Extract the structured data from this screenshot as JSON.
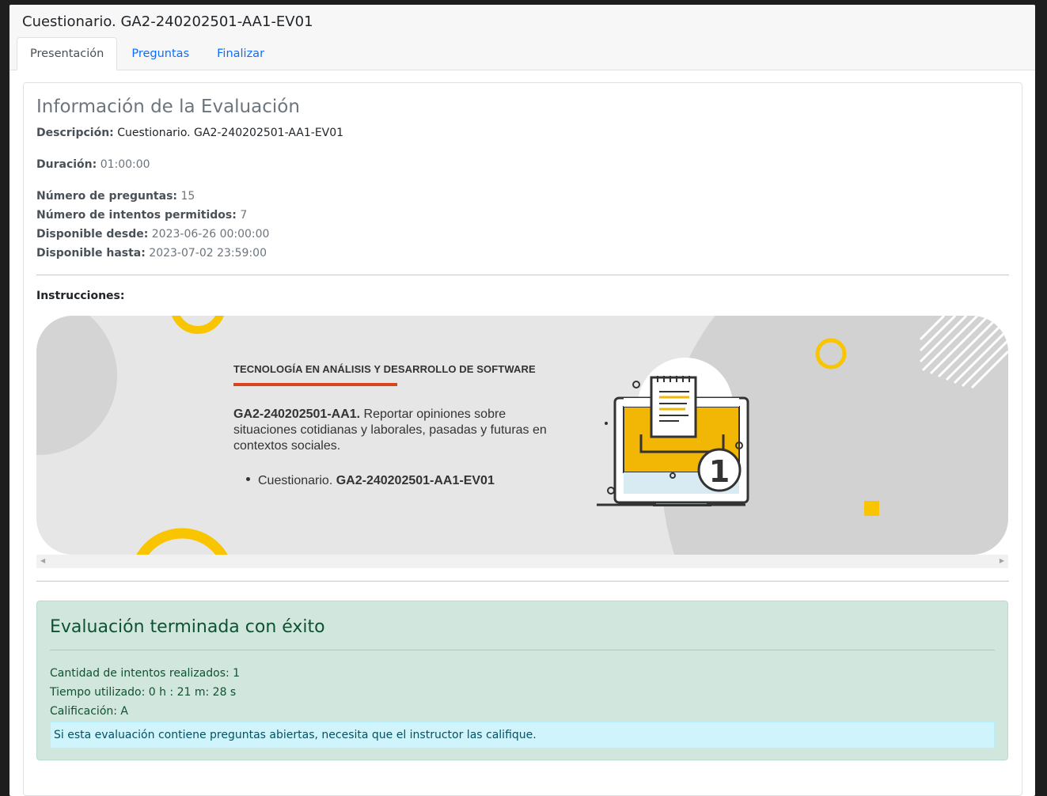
{
  "window": {
    "title": "Cuestionario. GA2-240202501-AA1-EV01"
  },
  "tabs": [
    {
      "label": "Presentación",
      "active": true
    },
    {
      "label": "Preguntas",
      "active": false
    },
    {
      "label": "Finalizar",
      "active": false
    }
  ],
  "info": {
    "title": "Información de la Evaluación",
    "descripcion_label": "Descripción:",
    "descripcion_value": "Cuestionario. GA2-240202501-AA1-EV01",
    "duracion_label": "Duración:",
    "duracion_value": "01:00:00",
    "preguntas_label": "Número de preguntas:",
    "preguntas_value": "15",
    "intentos_label": "Número de intentos permitidos:",
    "intentos_value": "7",
    "desde_label": "Disponible desde:",
    "desde_value": "2023-06-26 00:00:00",
    "hasta_label": "Disponible hasta:",
    "hasta_value": "2023-07-02 23:59:00"
  },
  "instructions": {
    "label": "Instrucciones:",
    "banner_title": "TECNOLOGÍA EN ANÁLISIS Y DESARROLLO DE SOFTWARE",
    "activity_code": "GA2-240202501-AA1.",
    "activity_text": " Reportar opiniones sobre situaciones cotidianas y laborales, pasadas y futuras en contextos sociales.",
    "bullet_prefix": "Cuestionario. ",
    "bullet_code": "GA2-240202501-AA1-EV01",
    "badge_number": "1",
    "colors": {
      "accent_orange": "#d9441c",
      "accent_yellow": "#f2b705",
      "ring_yellow": "#f9c400"
    }
  },
  "result": {
    "title": "Evaluación terminada con éxito",
    "intentos": "Cantidad de intentos realizados: 1",
    "tiempo": "Tiempo utilizado: 0 h : 21 m: 28 s",
    "calificacion": "Calificación: A",
    "note": "Si esta evaluación contiene preguntas abiertas, necesita que el instructor las califique."
  }
}
